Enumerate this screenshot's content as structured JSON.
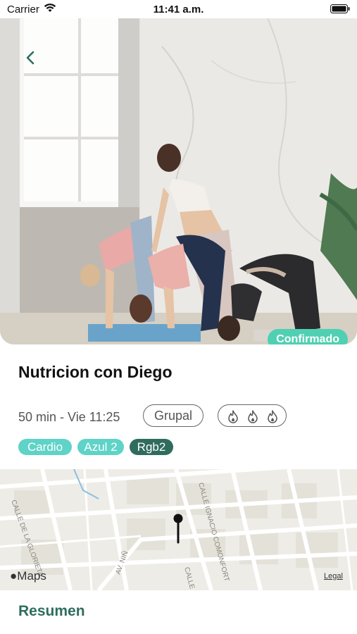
{
  "status_bar": {
    "carrier": "Carrier",
    "time": "11:41 a.m."
  },
  "hero": {
    "badge": "Confirmado",
    "back_icon": "chevron-left-icon"
  },
  "class": {
    "title": "Nutricion con Diego",
    "meta": "50 min - Vie 11:25",
    "type": "Grupal",
    "intensity_icons": [
      "flame-icon",
      "flame-icon",
      "flame-icon"
    ],
    "tags": [
      {
        "label": "Cardio",
        "color": "#5fd3c7"
      },
      {
        "label": "Azul 2",
        "color": "#5fd3c7"
      },
      {
        "label": "Rgb2",
        "color": "#2f6c5e"
      }
    ]
  },
  "map": {
    "provider": "Maps",
    "legal": "Legal",
    "streets": [
      "AV. NIÑ",
      "CALLE IGNACIO COMONFORT",
      "CALLE DE LA GLORIETA",
      "CALLE INDEPENDENCIA"
    ]
  },
  "section": {
    "title": "Resumen"
  },
  "colors": {
    "accent": "#4fd0b2",
    "dark_green": "#2f6c5e"
  }
}
